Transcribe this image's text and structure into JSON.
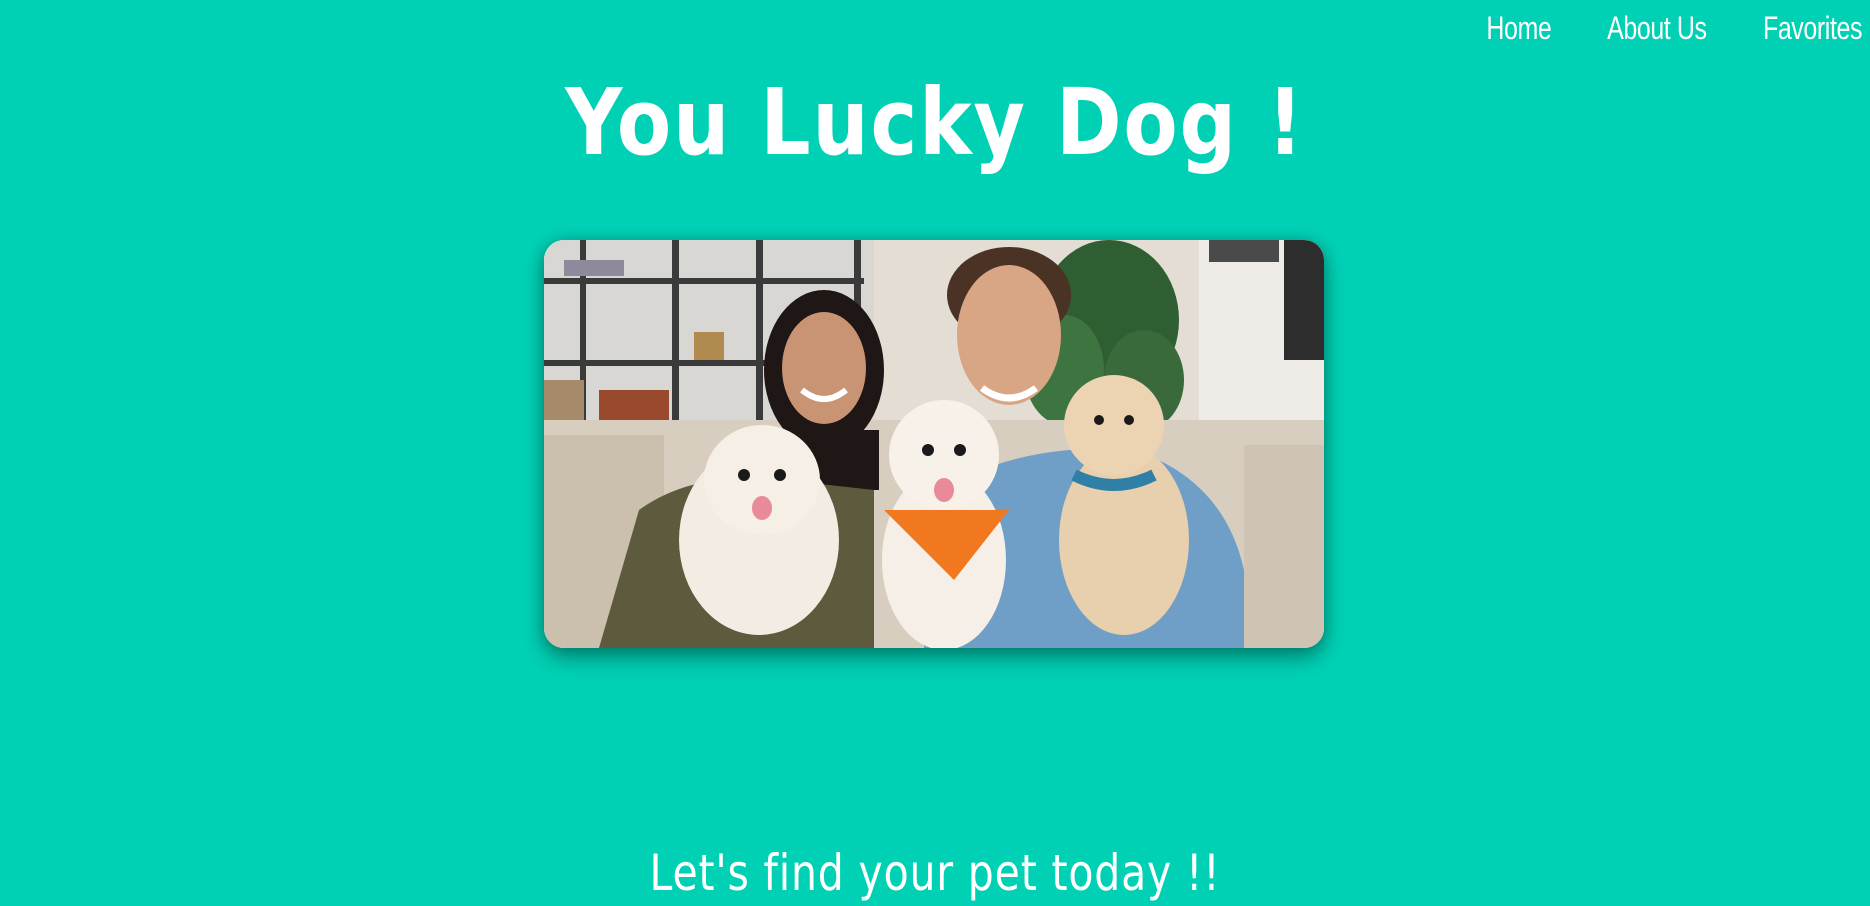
{
  "nav": {
    "items": [
      {
        "label": "Home"
      },
      {
        "label": "About Us"
      },
      {
        "label": "Favorites"
      }
    ]
  },
  "hero": {
    "title": "You Lucky Dog !",
    "tagline": "Let's find your pet today !!"
  },
  "colors": {
    "background": "#00d1b5",
    "text": "#ffffff",
    "bandana_orange": "#f2781f",
    "bandana_blue": "#2f7fa6"
  },
  "image": {
    "icon": "family-with-dogs-photo"
  }
}
